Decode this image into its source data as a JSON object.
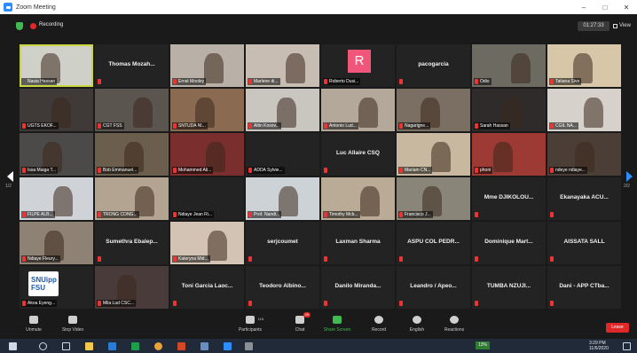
{
  "window": {
    "title": "Zoom Meeting",
    "minimize": "–",
    "maximize": "□",
    "close": "✕"
  },
  "topbar": {
    "recording_label": "Recording",
    "timer": "01:27:33",
    "view_label": "View"
  },
  "tiles": [
    {
      "name": "Nasia Hassan",
      "label_only": false,
      "video": true,
      "muted": false,
      "active": true,
      "color": "#cfd0c8"
    },
    {
      "name": "Thomas Mozah...",
      "label_only": true,
      "video": false,
      "muted": true
    },
    {
      "name": "Ernst Mooley",
      "label_only": false,
      "video": true,
      "muted": true,
      "color": "#b9b1a7"
    },
    {
      "name": "Marlene di...",
      "label_only": false,
      "video": true,
      "muted": true,
      "color": "#c8bdb2"
    },
    {
      "name": "Roberto Dusi...",
      "label_only": false,
      "video": false,
      "muted": true,
      "avatar": "R"
    },
    {
      "name": "pacogarcia",
      "label_only": true,
      "video": false,
      "muted": true
    },
    {
      "name": "Odio",
      "label_only": false,
      "video": true,
      "muted": true,
      "color": "#6d6a62"
    },
    {
      "name": "Tatiana Sivo",
      "label_only": false,
      "video": true,
      "muted": true,
      "color": "#d7c6a8"
    },
    {
      "name": "UGTS EKOF...",
      "label_only": false,
      "video": true,
      "muted": true,
      "color": "#3f3a38"
    },
    {
      "name": "CGT FSS",
      "label_only": false,
      "video": true,
      "muted": true,
      "color": "#5b5550"
    },
    {
      "name": "SNTUDA NI...",
      "label_only": false,
      "video": true,
      "muted": true,
      "color": "#8a6b52"
    },
    {
      "name": "Altin Kosov...",
      "label_only": false,
      "video": true,
      "muted": true,
      "color": "#c9c6c0"
    },
    {
      "name": "Antonio Lud...",
      "label_only": false,
      "video": true,
      "muted": true,
      "color": "#b4a89a"
    },
    {
      "name": "Nagarigne...",
      "label_only": false,
      "video": true,
      "muted": true,
      "color": "#7a6f62"
    },
    {
      "name": "Sarah Hassan",
      "label_only": false,
      "video": true,
      "muted": true,
      "color": "#2e2b2a"
    },
    {
      "name": "CGIL NA...",
      "label_only": false,
      "video": true,
      "muted": true,
      "color": "#d6d1ca"
    },
    {
      "name": "Issa Maiga T...",
      "label_only": false,
      "video": true,
      "muted": true,
      "color": "#4c4a48"
    },
    {
      "name": "Bob Emmanuel...",
      "label_only": false,
      "video": true,
      "muted": true,
      "color": "#6b5e4c"
    },
    {
      "name": "Mohammed Ali...",
      "label_only": false,
      "video": true,
      "muted": true,
      "color": "#7a2e2e"
    },
    {
      "name": "ADDA Sylvie...",
      "label_only": false,
      "video": false,
      "muted": true
    },
    {
      "name": "Luc Allaire CSQ",
      "label_only": true,
      "video": false,
      "muted": true
    },
    {
      "name": "Mariam CN...",
      "label_only": false,
      "video": true,
      "muted": true,
      "color": "#c8b8a0"
    },
    {
      "name": "phoni",
      "label_only": false,
      "video": true,
      "muted": true,
      "color": "#9c3a33"
    },
    {
      "name": "ndeye ndiaye...",
      "label_only": false,
      "video": true,
      "muted": true,
      "color": "#4a3e36"
    },
    {
      "name": "FILPE ALB...",
      "label_only": false,
      "video": true,
      "muted": true,
      "color": "#cfd3d8"
    },
    {
      "name": "TRONG CONG...",
      "label_only": false,
      "video": true,
      "muted": true,
      "color": "#b3a491"
    },
    {
      "name": "Ndiaye Jean Ri...",
      "label_only": false,
      "video": false,
      "muted": true
    },
    {
      "name": "Prof. Nandi...",
      "label_only": false,
      "video": true,
      "muted": true,
      "color": "#cdd2d6"
    },
    {
      "name": "Timothy Mcb...",
      "label_only": false,
      "video": true,
      "muted": true,
      "color": "#b9ab96"
    },
    {
      "name": "Francisco J...",
      "label_only": false,
      "video": true,
      "muted": true,
      "color": "#8a8579"
    },
    {
      "name": "Mme DJIKOLOU...",
      "label_only": true,
      "video": false,
      "muted": true
    },
    {
      "name": "Ekanayaka ACU...",
      "label_only": true,
      "video": false,
      "muted": true
    },
    {
      "name": "Ndiaye Fleury...",
      "label_only": false,
      "video": true,
      "muted": true,
      "color": "#8d8274"
    },
    {
      "name": "Sumethra Ebalep...",
      "label_only": true,
      "video": false,
      "muted": true
    },
    {
      "name": "Kateryna Mid...",
      "label_only": false,
      "video": true,
      "muted": true,
      "color": "#d3c3b4"
    },
    {
      "name": "serjcoumet",
      "label_only": true,
      "video": false,
      "muted": true
    },
    {
      "name": "Laxman Sharma",
      "label_only": true,
      "video": false,
      "muted": true
    },
    {
      "name": "ASPU COL PEDR...",
      "label_only": true,
      "video": false,
      "muted": true
    },
    {
      "name": "Dominique Mart...",
      "label_only": true,
      "video": false,
      "muted": true
    },
    {
      "name": "AISSATA SALL",
      "label_only": true,
      "video": false,
      "muted": true
    },
    {
      "name": "Akoa Eyeng...",
      "label_only": false,
      "video": false,
      "muted": true,
      "logo": "SNUipp FSU"
    },
    {
      "name": "Mila Lud CSC...",
      "label_only": false,
      "video": true,
      "muted": true,
      "color": "#4a3b3b"
    },
    {
      "name": "Toni Garcia Laoc...",
      "label_only": true,
      "video": false,
      "muted": true
    },
    {
      "name": "Teodoro Albino...",
      "label_only": true,
      "video": false,
      "muted": true
    },
    {
      "name": "Danilo Miranda...",
      "label_only": true,
      "video": false,
      "muted": true
    },
    {
      "name": "Leandro / Apeo...",
      "label_only": true,
      "video": false,
      "muted": true
    },
    {
      "name": "TUMBA NZUJI...",
      "label_only": true,
      "video": false,
      "muted": true
    },
    {
      "name": "Dani - APP CTba...",
      "label_only": true,
      "video": false,
      "muted": true
    }
  ],
  "nav": {
    "left_page": "1/2",
    "right_page": "2/2"
  },
  "toolbar": {
    "unmute": "Unmute",
    "stop_video": "Stop Video",
    "participants": "Participants",
    "participants_count": "116",
    "chat": "Chat",
    "chat_badge": "29",
    "share_screen": "Share Screen",
    "record": "Record",
    "interpretation": "English",
    "reactions": "Reactions",
    "leave": "Leave"
  },
  "taskbar": {
    "battery": "13%",
    "time": "3:29 PM",
    "date": "11/6/2020"
  },
  "colors": {
    "accent": "#2d8cff",
    "share_green": "#3fb950",
    "leave_red": "#e02828",
    "active_speaker": "#c9d640"
  }
}
